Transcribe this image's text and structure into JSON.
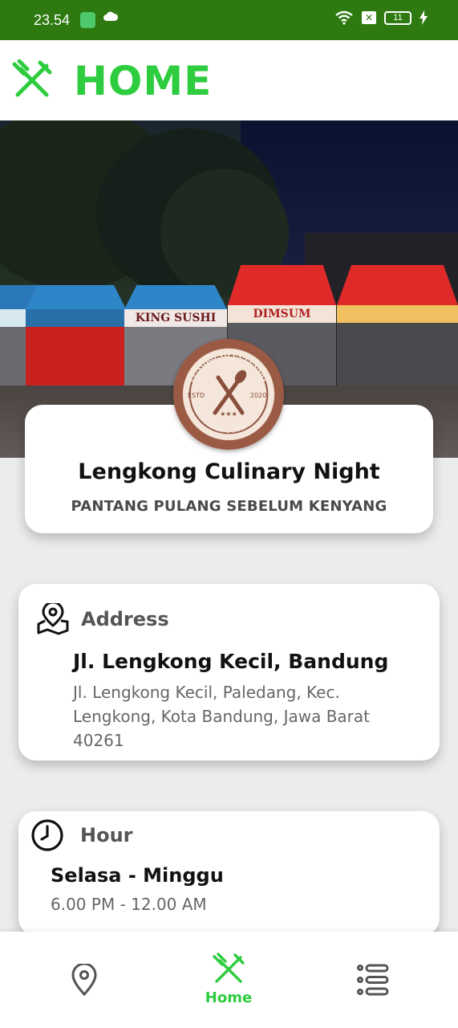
{
  "status_bar": {
    "time": "23.54",
    "battery": "11"
  },
  "app_bar": {
    "title": "HOME",
    "icon": "fork-knife-icon"
  },
  "hero": {
    "image": "night-street-food-market-photo",
    "stalls": [
      "KING SUSHI",
      "DIMSUM"
    ],
    "logo": {
      "top_text": "LENGKONG CULINARY",
      "left_text": "ESTD",
      "right_text": "2020",
      "bottom_text": "BEST STREET FOOD IN TOWN"
    }
  },
  "info_card": {
    "name": "Lengkong Culinary Night",
    "tagline": "PANTANG PULANG SEBELUM KENYANG"
  },
  "address": {
    "label": "Address",
    "street": "Jl. Lengkong Kecil, Bandung",
    "full": "Jl. Lengkong Kecil, Paledang, Kec. Lengkong, Kota Bandung, Jawa Barat 40261",
    "icon": "location-map-icon"
  },
  "hours": {
    "label": "Hour",
    "days": "Selasa - Minggu",
    "time": "6.00 PM - 12.00 AM",
    "icon": "clock-icon"
  },
  "bottom_nav": {
    "items": [
      {
        "icon": "location-pin-icon",
        "label": ""
      },
      {
        "icon": "fork-knife-icon",
        "label": "Home"
      },
      {
        "icon": "list-menu-icon",
        "label": ""
      }
    ]
  },
  "colors": {
    "accent": "#2ecc3f",
    "status_bar": "#2e7a10"
  }
}
